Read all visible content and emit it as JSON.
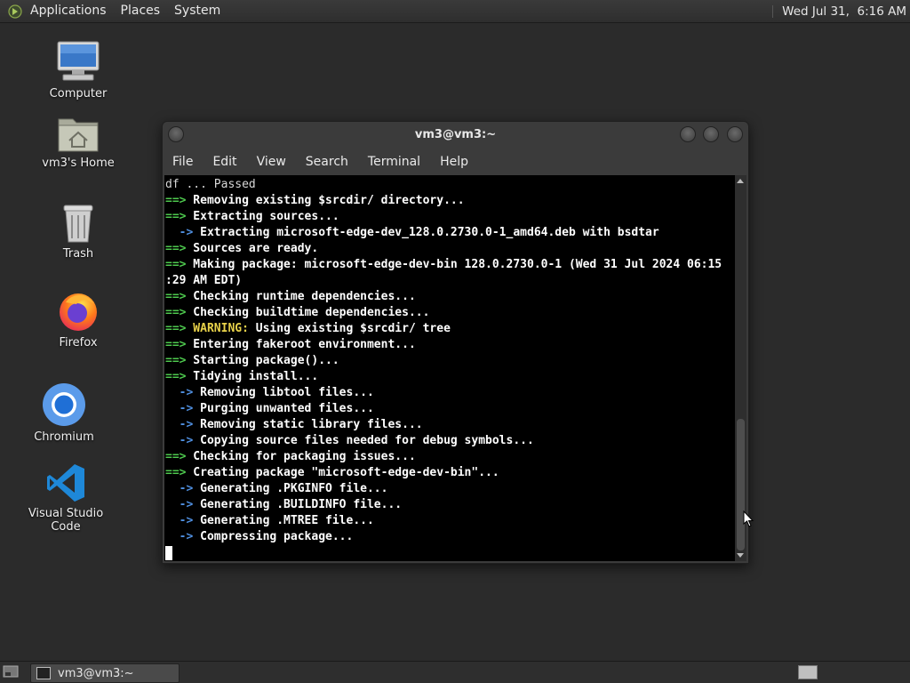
{
  "top_panel": {
    "menus": [
      "Applications",
      "Places",
      "System"
    ],
    "clock": "Wed Jul 31,  6:16 AM"
  },
  "desktop_icons": {
    "computer": "Computer",
    "home": "vm3's Home",
    "trash": "Trash",
    "firefox": "Firefox",
    "chromium": "Chromium",
    "vscode": "Visual Studio Code"
  },
  "window": {
    "title": "vm3@vm3:~",
    "menu": [
      "File",
      "Edit",
      "View",
      "Search",
      "Terminal",
      "Help"
    ]
  },
  "terminal": {
    "lines": [
      {
        "prefix": "",
        "text": "df ... Passed",
        "kind": "plain"
      },
      {
        "prefix": "==>",
        "text": " Removing existing $srcdir/ directory...",
        "kind": "bold"
      },
      {
        "prefix": "==>",
        "text": " Extracting sources...",
        "kind": "bold"
      },
      {
        "prefix": "  ->",
        "text": " Extracting microsoft-edge-dev_128.0.2730.0-1_amd64.deb with bsdtar",
        "kind": "bold"
      },
      {
        "prefix": "==>",
        "text": " Sources are ready.",
        "kind": "bold"
      },
      {
        "prefix": "==>",
        "text": " Making package: microsoft-edge-dev-bin 128.0.2730.0-1 (Wed 31 Jul 2024 06:15",
        "kind": "bold"
      },
      {
        "prefix": "",
        "text": ":29 AM EDT)",
        "kind": "bold"
      },
      {
        "prefix": "==>",
        "text": " Checking runtime dependencies...",
        "kind": "bold"
      },
      {
        "prefix": "==>",
        "text": " Checking buildtime dependencies...",
        "kind": "bold"
      },
      {
        "prefix": "==>",
        "warn": " WARNING:",
        "text": " Using existing $srcdir/ tree",
        "kind": "bold"
      },
      {
        "prefix": "==>",
        "text": " Entering fakeroot environment...",
        "kind": "bold"
      },
      {
        "prefix": "==>",
        "text": " Starting package()...",
        "kind": "bold"
      },
      {
        "prefix": "==>",
        "text": " Tidying install...",
        "kind": "bold"
      },
      {
        "prefix": "  ->",
        "text": " Removing libtool files...",
        "kind": "bold"
      },
      {
        "prefix": "  ->",
        "text": " Purging unwanted files...",
        "kind": "bold"
      },
      {
        "prefix": "  ->",
        "text": " Removing static library files...",
        "kind": "bold"
      },
      {
        "prefix": "  ->",
        "text": " Copying source files needed for debug symbols...",
        "kind": "bold"
      },
      {
        "prefix": "==>",
        "text": " Checking for packaging issues...",
        "kind": "bold"
      },
      {
        "prefix": "==>",
        "text": " Creating package \"microsoft-edge-dev-bin\"...",
        "kind": "bold"
      },
      {
        "prefix": "  ->",
        "text": " Generating .PKGINFO file...",
        "kind": "bold"
      },
      {
        "prefix": "  ->",
        "text": " Generating .BUILDINFO file...",
        "kind": "bold"
      },
      {
        "prefix": "  ->",
        "text": " Generating .MTREE file...",
        "kind": "bold"
      },
      {
        "prefix": "  ->",
        "text": " Compressing package...",
        "kind": "bold"
      }
    ]
  },
  "taskbar": {
    "task_label": "vm3@vm3:~"
  }
}
